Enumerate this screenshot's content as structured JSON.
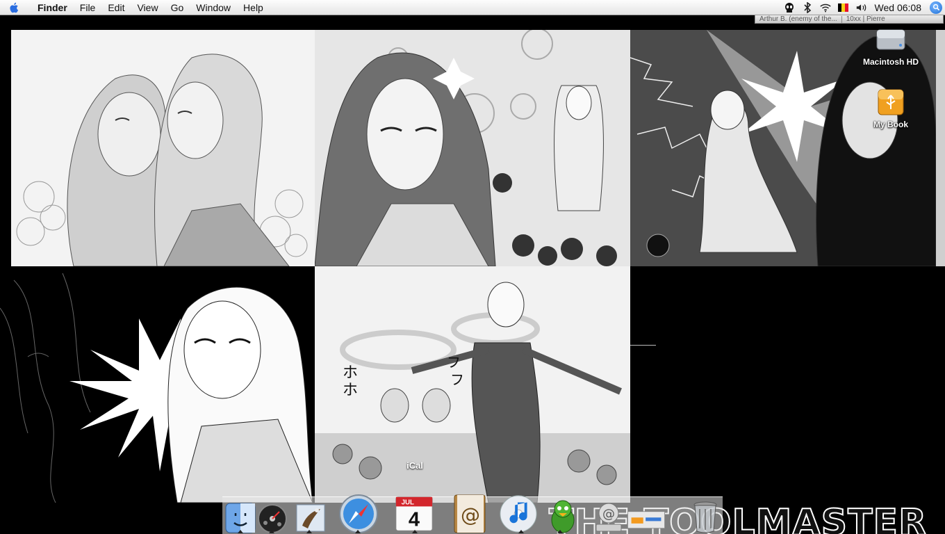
{
  "menubar": {
    "app_name": "Finder",
    "menus": [
      "File",
      "Edit",
      "View",
      "Go",
      "Window",
      "Help"
    ],
    "clock": "Wed 06:08",
    "status_icons": [
      "alien-icon",
      "bluetooth-icon",
      "wifi-icon",
      "belgian-flag-icon",
      "volume-icon",
      "spotlight-icon"
    ]
  },
  "tabstrip": {
    "items": [
      "Arthur B. (enemy of the...",
      "10xx | Pierre"
    ]
  },
  "desktop": {
    "icons": [
      {
        "label": "Macintosh HD",
        "icon": "hard-drive-icon"
      },
      {
        "label": "My Book",
        "icon": "usb-drive-icon"
      }
    ]
  },
  "dock": {
    "tooltip": "iCal",
    "ical_month": "JUL",
    "ical_day": "4",
    "items": [
      "finder-icon",
      "dashboard-icon",
      "mail-icon",
      "safari-icon",
      "ical-icon",
      "address-book-icon",
      "itunes-icon",
      "adium-icon",
      "applications-icon",
      "trash-icon"
    ]
  },
  "wallpaper": {
    "logo": "THE TOOLMASTER"
  }
}
